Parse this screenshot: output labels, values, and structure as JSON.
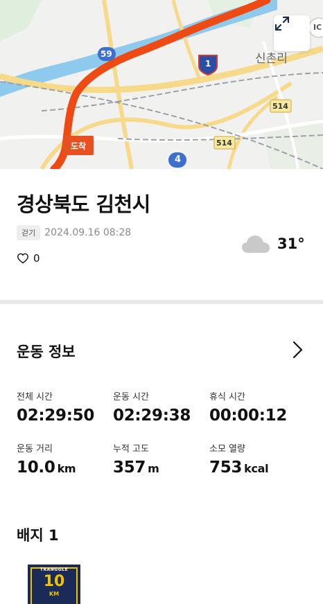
{
  "map": {
    "labels": {
      "route_59": "59",
      "route_1": "1",
      "route_4": "4",
      "route_514_a": "514",
      "route_514_b": "514",
      "place_name": "신촌리",
      "corner_label": "IC",
      "arrive_badge": "도착"
    },
    "colors": {
      "route": "#ee4a14",
      "river": "#8ec9ee",
      "road": "#f7d98a"
    }
  },
  "header": {
    "title": "경상북도 김천시",
    "activity_tag": "걷기",
    "datetime": "2024.09.16 08:28",
    "likes": "0",
    "temperature": "31°",
    "weather_icon": "cloud-icon"
  },
  "exercise": {
    "section_title": "운동 정보",
    "stats": [
      {
        "label": "전체 시간",
        "value": "02:29:50",
        "unit": ""
      },
      {
        "label": "운동 시간",
        "value": "02:29:38",
        "unit": ""
      },
      {
        "label": "휴식 시간",
        "value": "00:00:12",
        "unit": ""
      },
      {
        "label": "운동 거리",
        "value": "10.0",
        "unit": "km"
      },
      {
        "label": "누적 고도",
        "value": "357",
        "unit": "m"
      },
      {
        "label": "소모 열량",
        "value": "753",
        "unit": "kcal"
      }
    ]
  },
  "badges": {
    "section_title": "배지 1",
    "items": [
      {
        "top_text": "TRANGGLE",
        "number": "10",
        "unit": "KM"
      }
    ]
  }
}
